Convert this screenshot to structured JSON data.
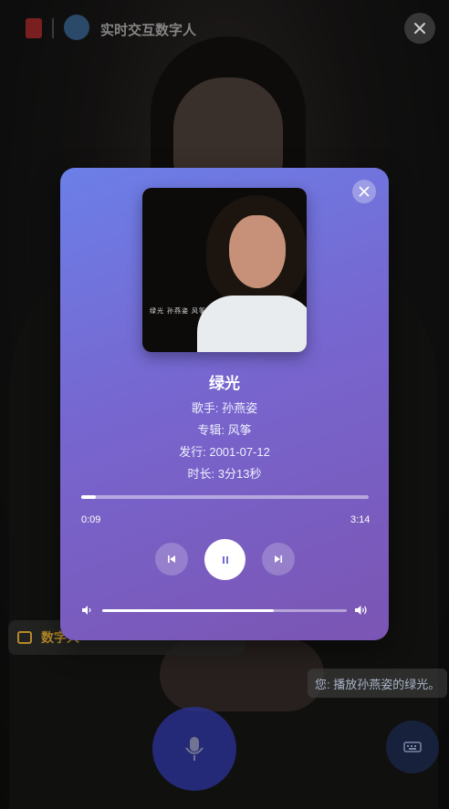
{
  "header": {
    "title": "实时交互数字人"
  },
  "background": {
    "digital_chip_text": "数字人",
    "user_message": "您: 播放孙燕姿的绿光。"
  },
  "player": {
    "song_title": "绿光",
    "artist_line": "歌手: 孙燕姿",
    "album_line": "专辑: 风筝",
    "release_line": "发行: 2001-07-12",
    "duration_line": "时长: 3分13秒",
    "current_time": "0:09",
    "total_time": "3:14",
    "progress_fraction": 0.05,
    "volume_fraction": 0.7,
    "cover_text": "绿光 孙燕姿 风筝"
  },
  "colors": {
    "card_gradient_start": "#6c7fe8",
    "card_gradient_end": "#7b55b3",
    "mic_button": "#2d35a3"
  },
  "icons": {
    "close": "close-icon",
    "prev": "skip-previous-icon",
    "play": "pause-icon",
    "next": "skip-next-icon",
    "mic": "microphone-icon",
    "keyboard": "keyboard-icon",
    "volume_low": "volume-low-icon",
    "volume_high": "volume-high-icon"
  }
}
